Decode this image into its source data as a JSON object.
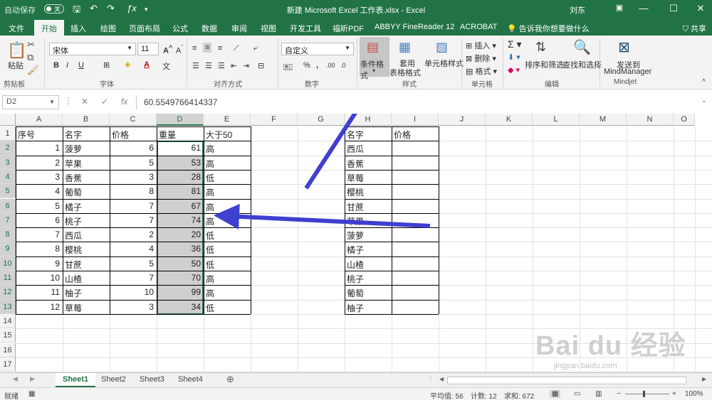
{
  "titlebar": {
    "autosave": "自动保存",
    "autosave_state": "关",
    "title": "新建 Microsoft Excel 工作表.xlsx  -  Excel",
    "user": "刘东"
  },
  "tabs": [
    "文件",
    "开始",
    "插入",
    "绘图",
    "页面布局",
    "公式",
    "数据",
    "审阅",
    "视图",
    "开发工具",
    "福昕PDF",
    "ABBYY FineReader 12",
    "ACROBAT"
  ],
  "tell_me": "告诉我你想要做什么",
  "share": "共享",
  "ribbon": {
    "paste": "粘贴",
    "clipboard": "剪贴板",
    "font_name": "宋体",
    "font_size": "11",
    "font": "字体",
    "alignment": "对齐方式",
    "number_format": "自定义",
    "number": "数字",
    "cond_format": "条件格式",
    "table_format_1": "套用",
    "table_format_2": "表格格式",
    "cell_style": "单元格样式",
    "styles": "样式",
    "insert": "插入",
    "delete": "删除",
    "format": "格式",
    "cells": "单元格",
    "sort_filter": "排序和筛选",
    "find_select": "查找和选择",
    "editing": "编辑",
    "mindmanager_1": "发送到",
    "mindmanager_2": "MindManager",
    "mindjet": "Mindjet"
  },
  "formula_bar": {
    "name_box": "D2",
    "value": "60.5549766414337"
  },
  "columns": [
    "A",
    "B",
    "C",
    "D",
    "E",
    "F",
    "G",
    "H",
    "I",
    "J",
    "K",
    "L",
    "M",
    "N",
    "O"
  ],
  "rows": [
    "1",
    "2",
    "3",
    "4",
    "5",
    "6",
    "7",
    "8",
    "9",
    "10",
    "11",
    "12",
    "13",
    "14",
    "15",
    "16",
    "17"
  ],
  "table1": {
    "headers": [
      "序号",
      "名字",
      "价格",
      "重量",
      "大于50"
    ],
    "rows": [
      [
        "1",
        "菠萝",
        "6",
        "61",
        "高"
      ],
      [
        "2",
        "苹果",
        "5",
        "53",
        "高"
      ],
      [
        "3",
        "香蕉",
        "3",
        "28",
        "低"
      ],
      [
        "4",
        "葡萄",
        "8",
        "81",
        "高"
      ],
      [
        "5",
        "橘子",
        "7",
        "67",
        "高"
      ],
      [
        "6",
        "桃子",
        "7",
        "74",
        "高"
      ],
      [
        "7",
        "西瓜",
        "2",
        "20",
        "低"
      ],
      [
        "8",
        "樱桃",
        "4",
        "36",
        "低"
      ],
      [
        "9",
        "甘蔗",
        "5",
        "50",
        "低"
      ],
      [
        "10",
        "山楂",
        "7",
        "70",
        "高"
      ],
      [
        "11",
        "柚子",
        "10",
        "99",
        "高"
      ],
      [
        "12",
        "草莓",
        "3",
        "34",
        "低"
      ]
    ]
  },
  "table2": {
    "headers": [
      "名字",
      "价格"
    ],
    "names": [
      "西瓜",
      "香蕉",
      "草莓",
      "樱桃",
      "甘蔗",
      "苹果",
      "菠萝",
      "橘子",
      "山楂",
      "桃子",
      "葡萄",
      "柚子"
    ]
  },
  "sheets": [
    "Sheet1",
    "Sheet2",
    "Sheet3",
    "Sheet4"
  ],
  "status": {
    "ready": "就绪",
    "average": "平均值: 56",
    "count": "计数: 12",
    "sum": "求和: 672",
    "zoom": "100%"
  },
  "watermark": "Bai du 经验",
  "watermark_url": "jingyan.baidu.com",
  "colors": {
    "excel_green": "#217346",
    "arrow": "#3f3fd0",
    "selection_fill": "#d0cece"
  }
}
